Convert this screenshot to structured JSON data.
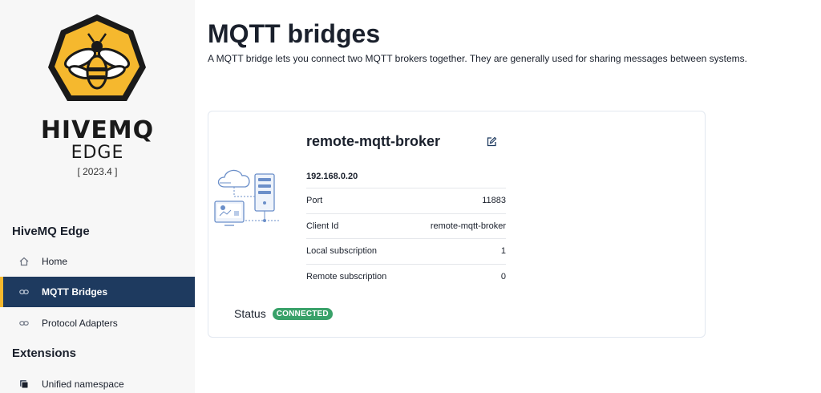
{
  "sidebar": {
    "brand": {
      "name": "HIVEMQ",
      "product": "EDGE",
      "version": "[ 2023.4 ]"
    },
    "sections": [
      {
        "heading": "HiveMQ Edge"
      },
      {
        "heading": "Extensions"
      }
    ],
    "items": [
      {
        "label": "Home",
        "icon": "home-icon"
      },
      {
        "label": "MQTT Bridges",
        "icon": "link-icon",
        "active": true
      },
      {
        "label": "Protocol Adapters",
        "icon": "link-icon"
      },
      {
        "label": "Unified namespace",
        "icon": "namespace-icon"
      }
    ]
  },
  "main": {
    "title": "MQTT bridges",
    "description": "A MQTT bridge lets you connect two MQTT brokers together. They are generally used for sharing messages between systems."
  },
  "bridge": {
    "name": "remote-mqtt-broker",
    "host": "192.168.0.20",
    "fields": [
      {
        "label": "Port",
        "value": "11883"
      },
      {
        "label": "Client Id",
        "value": "remote-mqtt-broker"
      },
      {
        "label": "Local subscription",
        "value": "1"
      },
      {
        "label": "Remote subscription",
        "value": "0"
      }
    ],
    "status_label": "Status",
    "status": "CONNECTED"
  },
  "colors": {
    "brand_yellow": "#f5b82e",
    "nav_active": "#1e3a5f",
    "status_green": "#38a169"
  }
}
